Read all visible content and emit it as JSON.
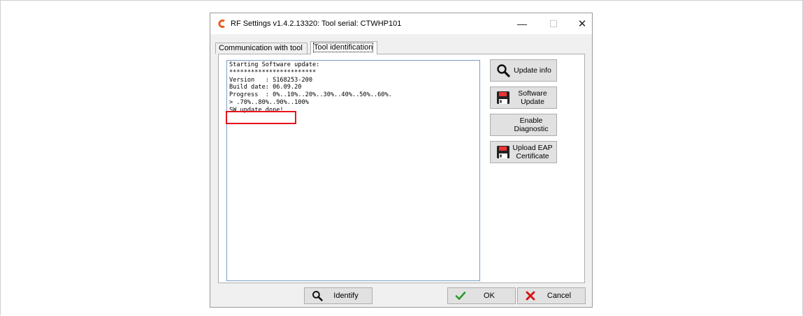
{
  "window": {
    "title": "RF Settings v1.4.2.13320: Tool serial: CTWHP101",
    "min_glyph": "—",
    "max_glyph": "☐",
    "close_glyph": "✕"
  },
  "tabs": [
    {
      "label": "Communication with tool",
      "selected": false
    },
    {
      "label": "Tool identification",
      "selected": true
    }
  ],
  "log": {
    "lines": [
      "Starting Software update:",
      "************************",
      "Version   : S168253-200",
      "Build date: 06.09.20",
      "Progress  : 0%..10%..20%..30%..40%..50%..60%.",
      "> .70%..80%..90%..100%",
      "SW update done!"
    ],
    "highlight_color": "#e8121b"
  },
  "side_buttons": {
    "update_info": {
      "line1": "Update info",
      "icon": "search-icon"
    },
    "software_update": {
      "line1": "Software",
      "line2": "Update",
      "icon": "floppy-disk-icon"
    },
    "enable_diagnostic": {
      "line1": "Enable",
      "line2": "Diagnostic"
    },
    "upload_eap": {
      "line1": "Upload EAP",
      "line2": "Certificate",
      "icon": "floppy-disk-icon"
    }
  },
  "bottom_buttons": {
    "identify": {
      "label": "Identify",
      "icon": "search-icon"
    },
    "ok": {
      "label": "OK",
      "icon": "checkmark-icon"
    },
    "cancel": {
      "label": "Cancel",
      "icon": "x-icon"
    }
  },
  "colors": {
    "brand_logo": "#e85a1a",
    "ok_green": "#2a9a2a",
    "cancel_red": "#d81010"
  }
}
